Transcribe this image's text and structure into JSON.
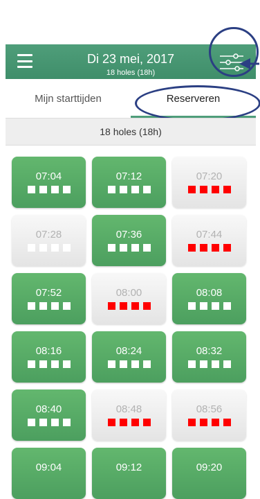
{
  "header": {
    "title": "Di 23 mei, 2017",
    "subtitle": "18 holes (18h)",
    "menu_icon": "hamburger-icon",
    "filter_icon": "sliders-icon",
    "background": "#4f9e7a"
  },
  "tabs": [
    {
      "label": "Mijn starttijden",
      "active": false
    },
    {
      "label": "Reserveren",
      "active": true
    }
  ],
  "section": {
    "label": "18 holes (18h)"
  },
  "colors": {
    "available": "#5aab67",
    "full": "#ff0000",
    "free_slot": "#ffffff",
    "annotation": "#2b3f83"
  },
  "slots": [
    {
      "time": "07:04",
      "state": "available",
      "marks": [
        "free",
        "free",
        "free",
        "free"
      ]
    },
    {
      "time": "07:12",
      "state": "available",
      "marks": [
        "free",
        "free",
        "free",
        "free"
      ]
    },
    {
      "time": "07:20",
      "state": "full",
      "marks": [
        "taken",
        "taken",
        "taken",
        "taken"
      ]
    },
    {
      "time": "07:28",
      "state": "disabled",
      "marks": [
        "free",
        "free",
        "free",
        "free"
      ]
    },
    {
      "time": "07:36",
      "state": "available",
      "marks": [
        "free",
        "free",
        "free",
        "free"
      ]
    },
    {
      "time": "07:44",
      "state": "full",
      "marks": [
        "taken",
        "taken",
        "taken",
        "taken"
      ]
    },
    {
      "time": "07:52",
      "state": "available",
      "marks": [
        "free",
        "free",
        "free",
        "free"
      ]
    },
    {
      "time": "08:00",
      "state": "full",
      "marks": [
        "taken",
        "taken",
        "taken",
        "taken"
      ]
    },
    {
      "time": "08:08",
      "state": "available",
      "marks": [
        "free",
        "free",
        "free",
        "free"
      ]
    },
    {
      "time": "08:16",
      "state": "available",
      "marks": [
        "free",
        "free",
        "free",
        "free"
      ]
    },
    {
      "time": "08:24",
      "state": "available",
      "marks": [
        "free",
        "free",
        "free",
        "free"
      ]
    },
    {
      "time": "08:32",
      "state": "available",
      "marks": [
        "free",
        "free",
        "free",
        "free"
      ]
    },
    {
      "time": "08:40",
      "state": "available",
      "marks": [
        "free",
        "free",
        "free",
        "free"
      ]
    },
    {
      "time": "08:48",
      "state": "full",
      "marks": [
        "taken",
        "taken",
        "taken",
        "taken"
      ]
    },
    {
      "time": "08:56",
      "state": "full",
      "marks": [
        "taken",
        "taken",
        "taken",
        "taken"
      ]
    },
    {
      "time": "09:04",
      "state": "available",
      "marks": []
    },
    {
      "time": "09:12",
      "state": "available",
      "marks": []
    },
    {
      "time": "09:20",
      "state": "available",
      "marks": []
    }
  ]
}
